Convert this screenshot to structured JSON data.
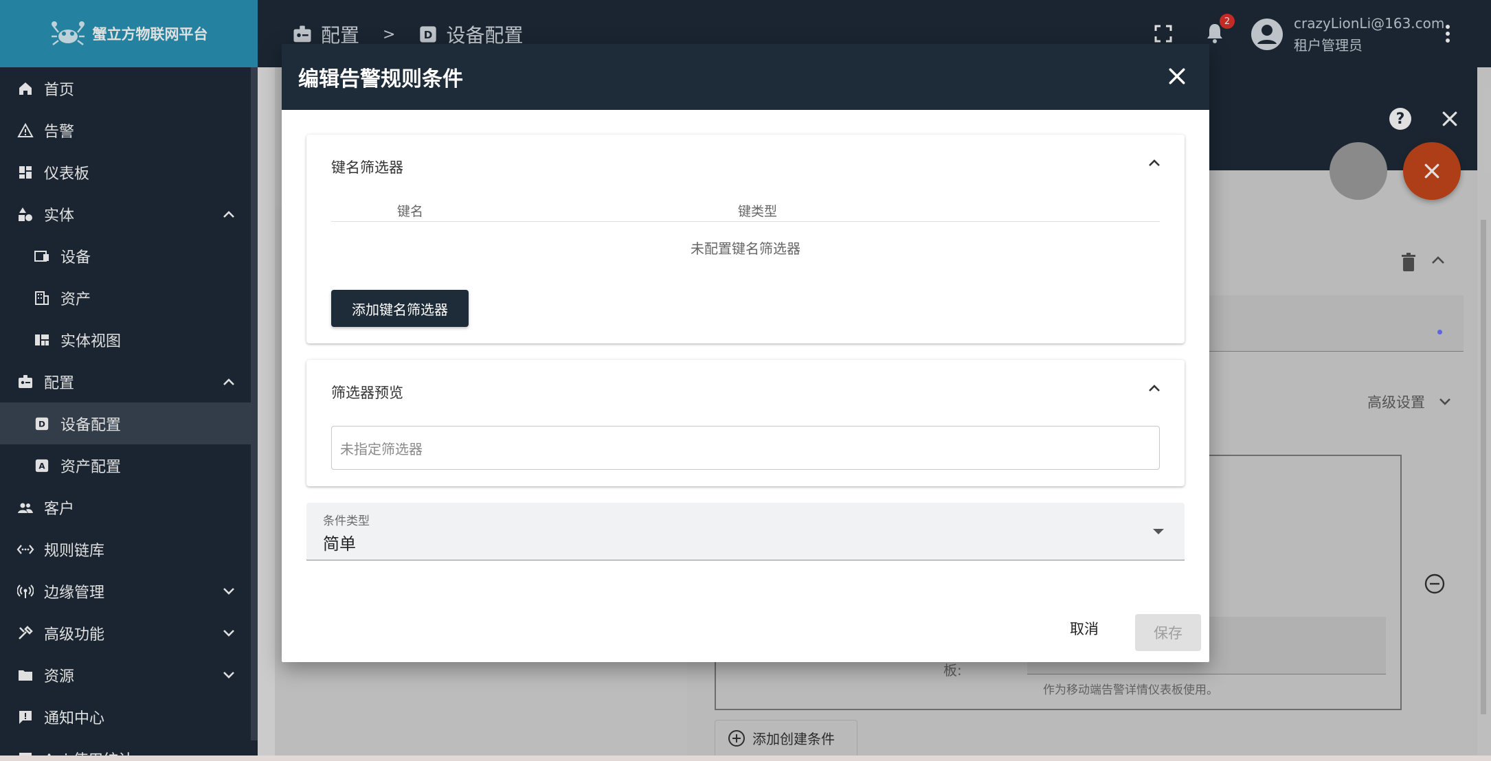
{
  "app": {
    "brand": "蟹立方物联网平台"
  },
  "sidebar": {
    "items": [
      {
        "label": "首页",
        "icon": "home-icon"
      },
      {
        "label": "告警",
        "icon": "warning-icon"
      },
      {
        "label": "仪表板",
        "icon": "dashboard-icon"
      },
      {
        "label": "实体",
        "icon": "shapes-icon",
        "expanded": true
      },
      {
        "label": "设备",
        "icon": "devices-icon"
      },
      {
        "label": "资产",
        "icon": "building-icon"
      },
      {
        "label": "实体视图",
        "icon": "view-quilt-icon"
      },
      {
        "label": "配置",
        "icon": "settings-badge-icon",
        "expanded": true
      },
      {
        "label": "设备配置",
        "icon": "device-profile-icon",
        "active": true
      },
      {
        "label": "资产配置",
        "icon": "asset-profile-icon"
      },
      {
        "label": "客户",
        "icon": "people-icon"
      },
      {
        "label": "规则链库",
        "icon": "settings-ethernet-icon"
      },
      {
        "label": "边缘管理",
        "icon": "router-icon",
        "expandable": true
      },
      {
        "label": "高级功能",
        "icon": "build-icon",
        "expandable": true
      },
      {
        "label": "资源",
        "icon": "folder-icon",
        "expandable": true
      },
      {
        "label": "通知中心",
        "icon": "feedback-icon"
      },
      {
        "label": "Api 使用统计",
        "icon": "insert-chart-icon"
      }
    ]
  },
  "topbar": {
    "breadcrumb": [
      {
        "label": "配置"
      },
      {
        "label": "设备配置"
      }
    ],
    "separator": ">",
    "notification_count": "2",
    "user_email": "crazyLionLi@163.com",
    "user_role": "租户管理员"
  },
  "background": {
    "advanced_settings": "高级设置",
    "dashboard_label": "板:",
    "dashboard_hint": "作为移动端告警详情仪表板使用。",
    "add_create_condition": "添加创建条件"
  },
  "dialog": {
    "title": "编辑告警规则条件",
    "key_filter": {
      "title": "键名筛选器",
      "col_key": "键名",
      "col_key_type": "键类型",
      "empty": "未配置键名筛选器",
      "add_button": "添加键名筛选器"
    },
    "preview": {
      "title": "筛选器预览",
      "placeholder": "未指定筛选器"
    },
    "condition_type": {
      "label": "条件类型",
      "value": "简单"
    },
    "cancel": "取消",
    "save": "保存"
  },
  "colors": {
    "sidebar_bg": "#1e2b38",
    "brand_bg": "#2a93b7",
    "fab": "#c7471c",
    "badge": "#e0312b"
  }
}
